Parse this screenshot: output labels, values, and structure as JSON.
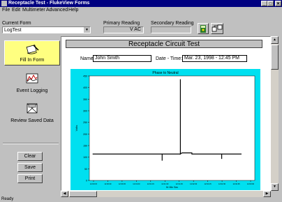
{
  "window": {
    "title": "Receptacle Test - FlukeView Forms",
    "controls": [
      "_",
      "□",
      "✕"
    ]
  },
  "menu": [
    "File",
    "Edit",
    "Multimeter",
    "Advanced",
    "Help"
  ],
  "toolbar": {
    "current_form_label": "Current Form",
    "current_form_value": "LogTest",
    "primary_reading_label": "Primary Reading",
    "primary_reading_value": "V AC",
    "secondary_reading_label": "Secondary Reading",
    "secondary_reading_value": "",
    "icons": [
      "meter-icon",
      "connect-icon"
    ]
  },
  "sidebar": {
    "nav": [
      {
        "label": "Fill In Form",
        "icon": "fill-form-icon",
        "active": true
      },
      {
        "label": "Event Logging",
        "icon": "event-logging-icon",
        "active": false
      },
      {
        "label": "Review Saved Data",
        "icon": "review-data-icon",
        "active": false
      }
    ],
    "buttons": [
      "Clear",
      "Save",
      "Print"
    ]
  },
  "form": {
    "title": "Receptacle Circuit Test",
    "name_label": "Name:",
    "name_value": "John Smith",
    "datetime_label": "Date - Time:",
    "datetime_value": "Mar. 23, 1998 - 12:45 PM"
  },
  "chart_data": {
    "type": "line",
    "title": "Phase to Neutral",
    "ylabel": "Volts",
    "xlabel": "Hr Min Sec",
    "yticks": [
      "450",
      "400",
      "350",
      "300",
      "250",
      "200",
      "150",
      "100",
      "50",
      "0"
    ],
    "xticks": [
      "12:00:15",
      "12:00:30",
      "12:00:45",
      "12:01:00",
      "12:01:15",
      "12:01:30",
      "12:01:45",
      "12:02:00",
      "12:02:15",
      "12:02:30",
      "12:02:45",
      "12:03:00"
    ],
    "colors": {
      "background": "#00e0f0",
      "plot": "#ffffff",
      "trace": "#000000"
    }
  },
  "status": "Ready"
}
